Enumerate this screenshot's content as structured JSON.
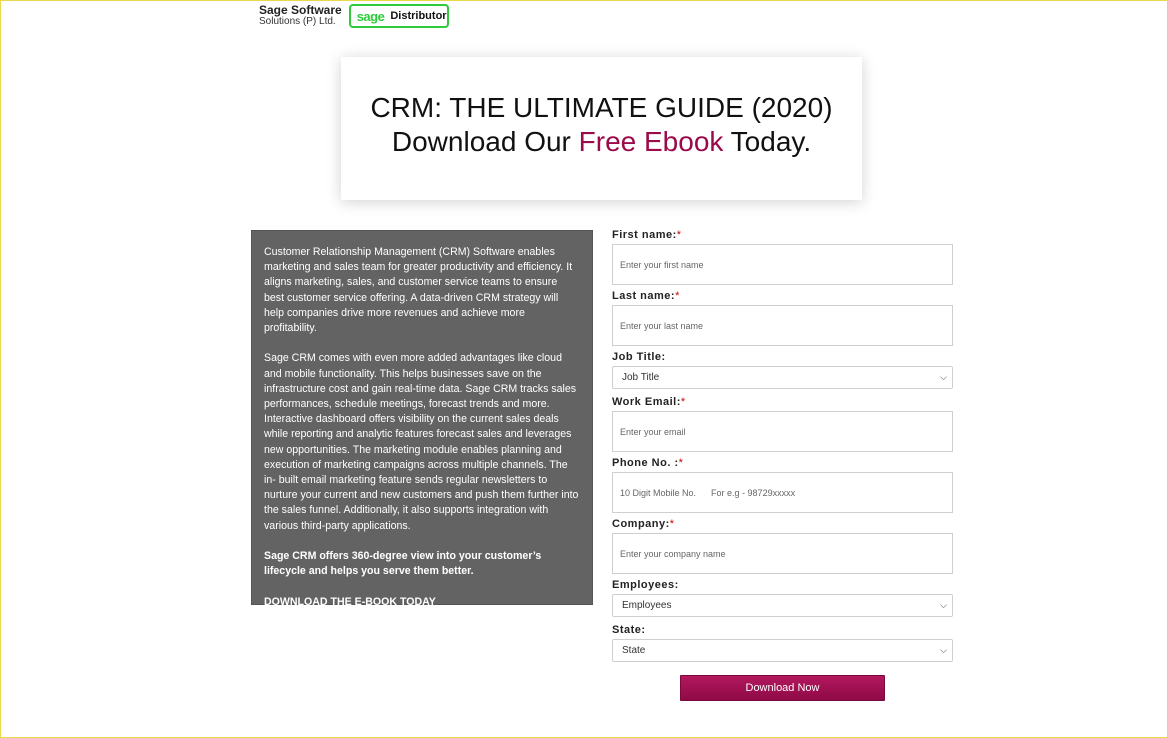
{
  "brand": {
    "name": "Sage Software",
    "sub": "Solutions (P) Ltd.",
    "badge_sage": "sage",
    "badge_distributor": "Distributor"
  },
  "hero": {
    "line1": "CRM: THE ULTIMATE GUIDE (2020)",
    "line2_prefix": "Download Our ",
    "line2_accent": "Free Ebook",
    "line2_suffix": " Today."
  },
  "info": {
    "para1": "Customer Relationship Management (CRM) Software enables marketing and sales team for greater productivity and efficiency. It aligns marketing, sales, and customer service teams to ensure best customer service offering. A data-driven CRM strategy will help companies drive more revenues and achieve more profitability.",
    "para2": "Sage CRM comes with even more added advantages like cloud and mobile functionality. This helps businesses save on the infrastructure cost and gain real-time data. Sage CRM tracks sales performances, schedule meetings, forecast trends and more. Interactive dashboard offers visibility on the current sales deals while reporting and analytic features forecast sales and leverages new opportunities. The marketing module enables planning and execution of marketing campaigns across multiple channels. The in- built email marketing feature sends regular newsletters to nurture your current and new customers and push them further into the sales funnel. Additionally, it also supports integration with various third-party applications.",
    "para3": "Sage CRM offers 360-degree view into your customer’s lifecycle and helps you serve them better.",
    "para4": "DOWNLOAD THE E-BOOK TODAY"
  },
  "form": {
    "first_name": {
      "label": "First name:",
      "required": "*",
      "placeholder": "Enter your first name"
    },
    "last_name": {
      "label": "Last name:",
      "required": "*",
      "placeholder": "Enter your last name"
    },
    "job_title": {
      "label": "Job Title:",
      "value": "Job Title"
    },
    "work_email": {
      "label": "Work Email:",
      "required": "*",
      "placeholder": "Enter your email"
    },
    "phone": {
      "label": "Phone No. :",
      "required": "*",
      "placeholder": "10 Digit Mobile No.      For e.g - 98729xxxxx"
    },
    "company": {
      "label": "Company:",
      "required": "*",
      "placeholder": "Enter your company name"
    },
    "employees": {
      "label": "Employees:",
      "value": "Employees"
    },
    "state": {
      "label": "State:",
      "value": "State"
    },
    "submit_label": "Download Now"
  },
  "colors": {
    "accent": "#9b0a4a",
    "badge_green": "#2dcc3b",
    "panel_bg": "#636363"
  }
}
